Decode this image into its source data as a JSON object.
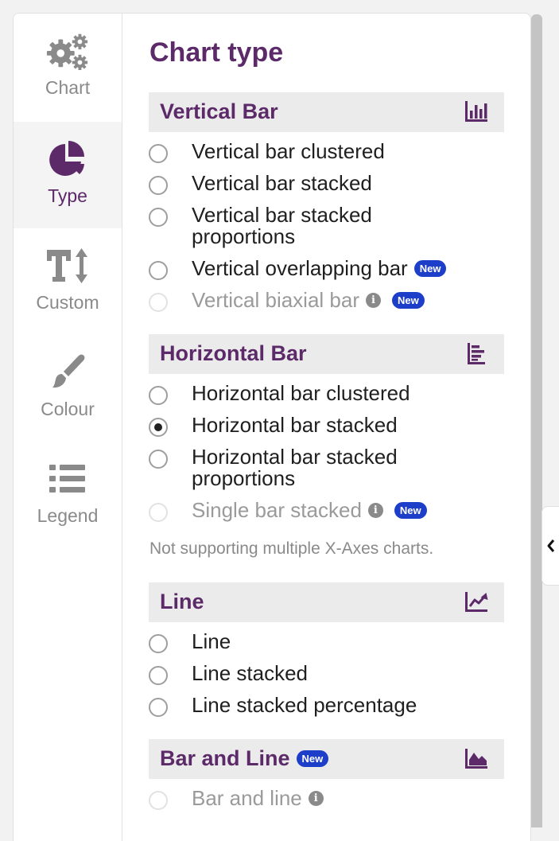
{
  "sidebar": {
    "items": [
      {
        "label": "Chart",
        "icon": "gears-icon"
      },
      {
        "label": "Type",
        "icon": "pie-chart-icon"
      },
      {
        "label": "Custom",
        "icon": "text-size-icon"
      },
      {
        "label": "Colour",
        "icon": "paintbrush-icon"
      },
      {
        "label": "Legend",
        "icon": "list-icon"
      }
    ],
    "active": "Type"
  },
  "main": {
    "title": "Chart type",
    "sections": [
      {
        "title": "Vertical Bar",
        "icon": "vertical-bar-chart-icon",
        "options": [
          {
            "label": "Vertical bar clustered"
          },
          {
            "label": "Vertical bar stacked"
          },
          {
            "label": "Vertical bar stacked proportions"
          },
          {
            "label": "Vertical overlapping bar",
            "badge": "New"
          },
          {
            "label": "Vertical biaxial bar",
            "badge": "New",
            "disabled": true
          }
        ]
      },
      {
        "title": "Horizontal Bar",
        "icon": "horizontal-bar-chart-icon",
        "options": [
          {
            "label": "Horizontal bar clustered"
          },
          {
            "label": "Horizontal bar stacked",
            "selected": true
          },
          {
            "label": "Horizontal bar stacked proportions"
          },
          {
            "label": "Single bar stacked",
            "badge": "New",
            "disabled": true
          }
        ],
        "note": "Not supporting multiple X-Axes charts."
      },
      {
        "title": "Line",
        "icon": "line-chart-icon",
        "options": [
          {
            "label": "Line"
          },
          {
            "label": "Line stacked"
          },
          {
            "label": "Line stacked percentage"
          }
        ]
      },
      {
        "title": "Bar and Line",
        "title_badge": "New",
        "icon": "area-chart-icon",
        "options": [
          {
            "label": "Bar and line",
            "disabled": true
          }
        ]
      }
    ]
  },
  "colors": {
    "accent": "#5c2a68",
    "badge": "#1d3ec9",
    "muted": "#8a8a8a"
  }
}
